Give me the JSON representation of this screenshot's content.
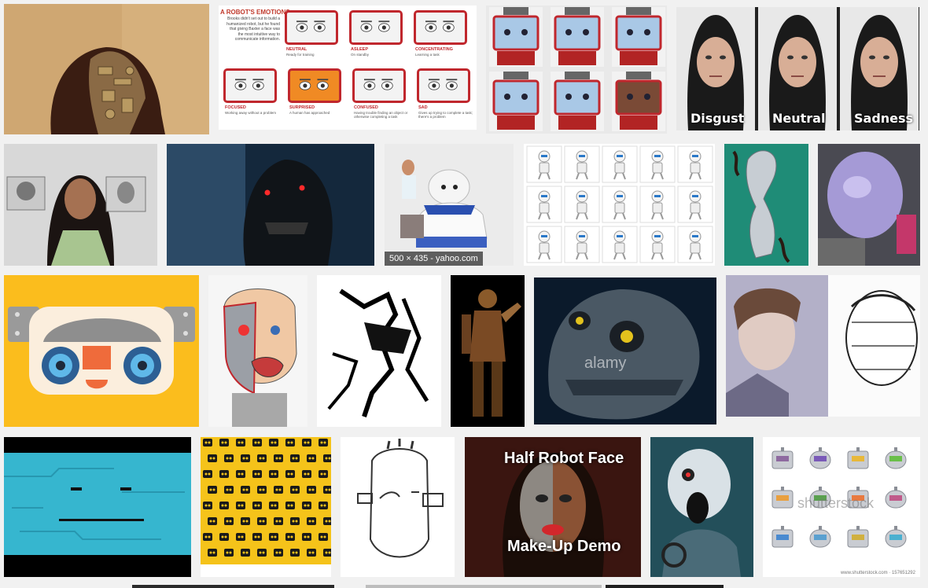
{
  "row1": {
    "t2": {
      "heading": "A ROBOT'S EMOTIONS",
      "intro": "Brooks didn't set out to build a humanized robot, but he found that giving Baxter a face was the most intuitive way to communicate information.",
      "faces": [
        {
          "state": "NEUTRAL",
          "desc": "Ready for training"
        },
        {
          "state": "ASLEEP",
          "desc": "On standby"
        },
        {
          "state": "CONCENTRATING",
          "desc": "Learning a task"
        },
        {
          "state": "FOCUSED",
          "desc": "Working away without a problem"
        },
        {
          "state": "SURPRISED",
          "desc": "A human has approached"
        },
        {
          "state": "CONFUSED",
          "desc": "Having trouble finding an object or otherwise completing a task"
        },
        {
          "state": "SAD",
          "desc": "Gives up trying to complete a task; there's a problem"
        }
      ]
    },
    "t4": {
      "labels": [
        "Disgust",
        "Neutral",
        "Sadness"
      ]
    }
  },
  "row2": {
    "t3": {
      "caption": "500 × 435 - yahoo.com"
    }
  },
  "row3": {
    "t5": {
      "watermark": "alamy"
    }
  },
  "row4": {
    "t4": {
      "title": "Half Robot Face",
      "subtitle": "Make-Up Demo"
    },
    "t6": {
      "watermark": "shutterstock",
      "footer": "www.shutterstock.com · 157651292"
    }
  }
}
